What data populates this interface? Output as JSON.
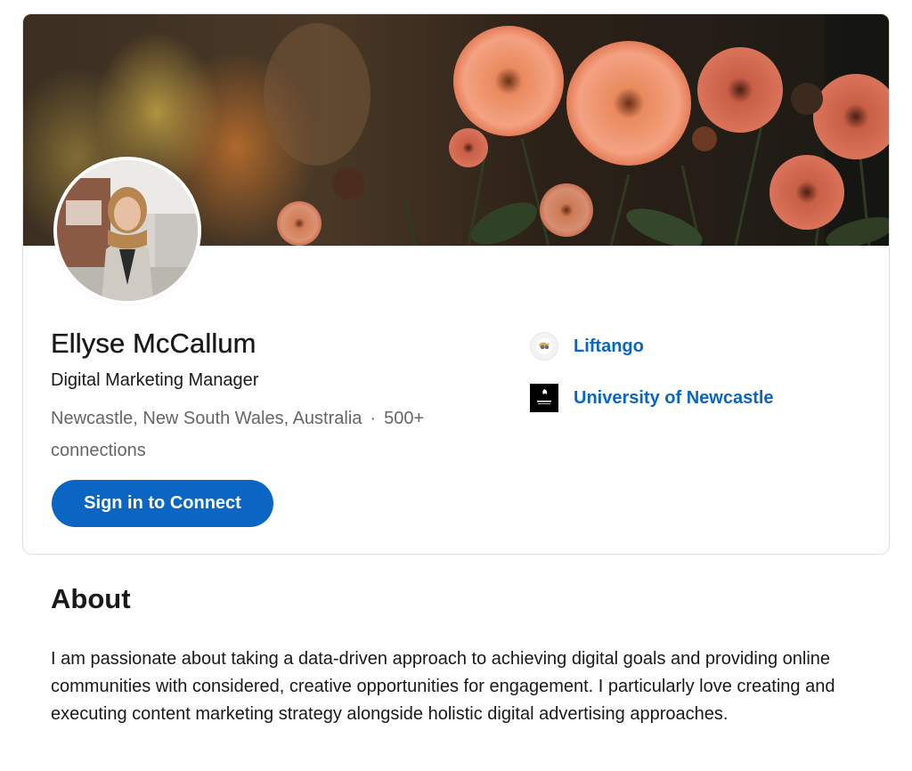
{
  "profile": {
    "name": "Ellyse McCallum",
    "headline": "Digital Marketing Manager",
    "location": "Newcastle, New South Wales, Australia",
    "separator": "·",
    "connections": "500+ connections"
  },
  "actions": {
    "connect_label": "Sign in to Connect"
  },
  "organizations": [
    {
      "name": "Liftango",
      "logo": "liftango-logo"
    },
    {
      "name": "University of Newcastle",
      "logo": "university-of-newcastle-logo"
    }
  ],
  "about": {
    "title": "About",
    "text": "I am passionate about taking a data-driven approach to achieving digital goals and providing online communities with considered, creative opportunities for engagement. I particularly love creating and executing content marketing strategy alongside holistic digital advertising approaches."
  },
  "colors": {
    "brand_blue": "#0a66c2",
    "secondary_text": "#666666",
    "card_border": "#e0dfdc"
  }
}
